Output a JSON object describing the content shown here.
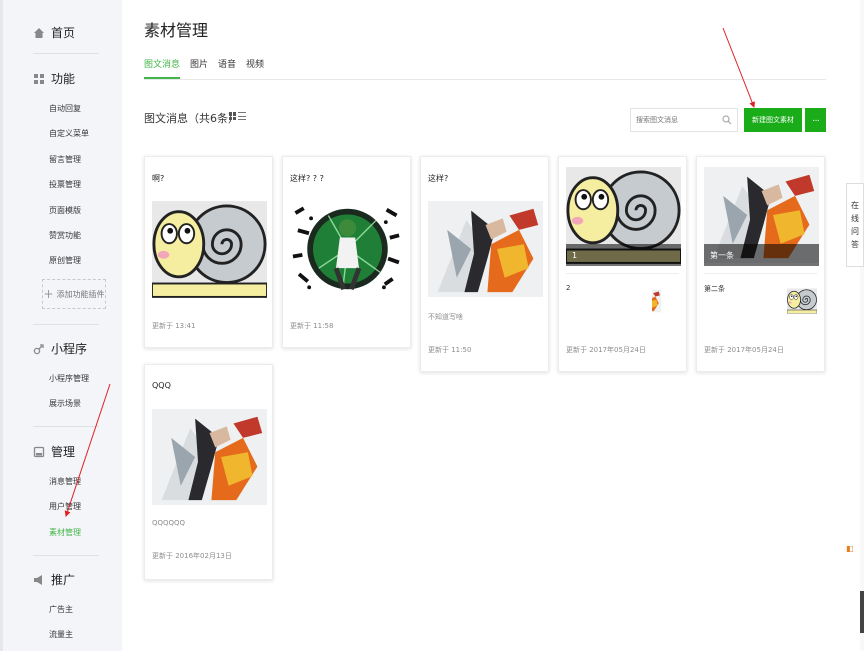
{
  "sidebar": {
    "home": "首页",
    "groups": [
      {
        "title": "功能",
        "items": [
          "自动回复",
          "自定义菜单",
          "留言管理",
          "投票管理",
          "页面模版",
          "赞赏功能",
          "原创管理"
        ]
      },
      {
        "title": "小程序",
        "items": [
          "小程序管理",
          "展示场景"
        ]
      },
      {
        "title": "管理",
        "items": [
          "消息管理",
          "用户管理",
          "素材管理"
        ]
      },
      {
        "title": "推广",
        "items": [
          "广告主",
          "流量主"
        ]
      }
    ],
    "add_plugin": "添加功能插件",
    "active_item": "素材管理"
  },
  "main": {
    "page_title": "素材管理",
    "tabs": [
      "图文消息",
      "图片",
      "语音",
      "视频"
    ],
    "active_tab": "图文消息",
    "section_title": "图文消息（共6条）",
    "search_placeholder": "搜索图文消息",
    "new_button": "新建图文素材",
    "more_button": "···"
  },
  "cards": [
    {
      "title": "啊?",
      "time": "更新于 13:41",
      "image": "cartoon-snail"
    },
    {
      "title": "这样? ? ?",
      "time": "更新于 11:58",
      "image": "anime-character-circle"
    },
    {
      "title": "这样?",
      "desc": "不知道写啥",
      "time": "更新于 11:50",
      "image": "illustration-warrior"
    },
    {
      "cover_label": "1",
      "sub_title": "2",
      "time": "更新于 2017年05月24日",
      "image": "cartoon-snail"
    },
    {
      "cover_label": "第一条",
      "sub_title": "第二条",
      "time": "更新于 2017年05月24日",
      "image": "illustration-warrior"
    },
    {
      "title": "QQQ",
      "desc": "QQQQQQ",
      "time": "更新于 2016年02月13日",
      "image": "illustration-warrior"
    }
  ],
  "widget": {
    "online_consult": [
      "在",
      "线",
      "问",
      "答"
    ]
  },
  "colors": {
    "accent": "#44b549",
    "button": "#1aad19",
    "annotation": "#e02020"
  }
}
